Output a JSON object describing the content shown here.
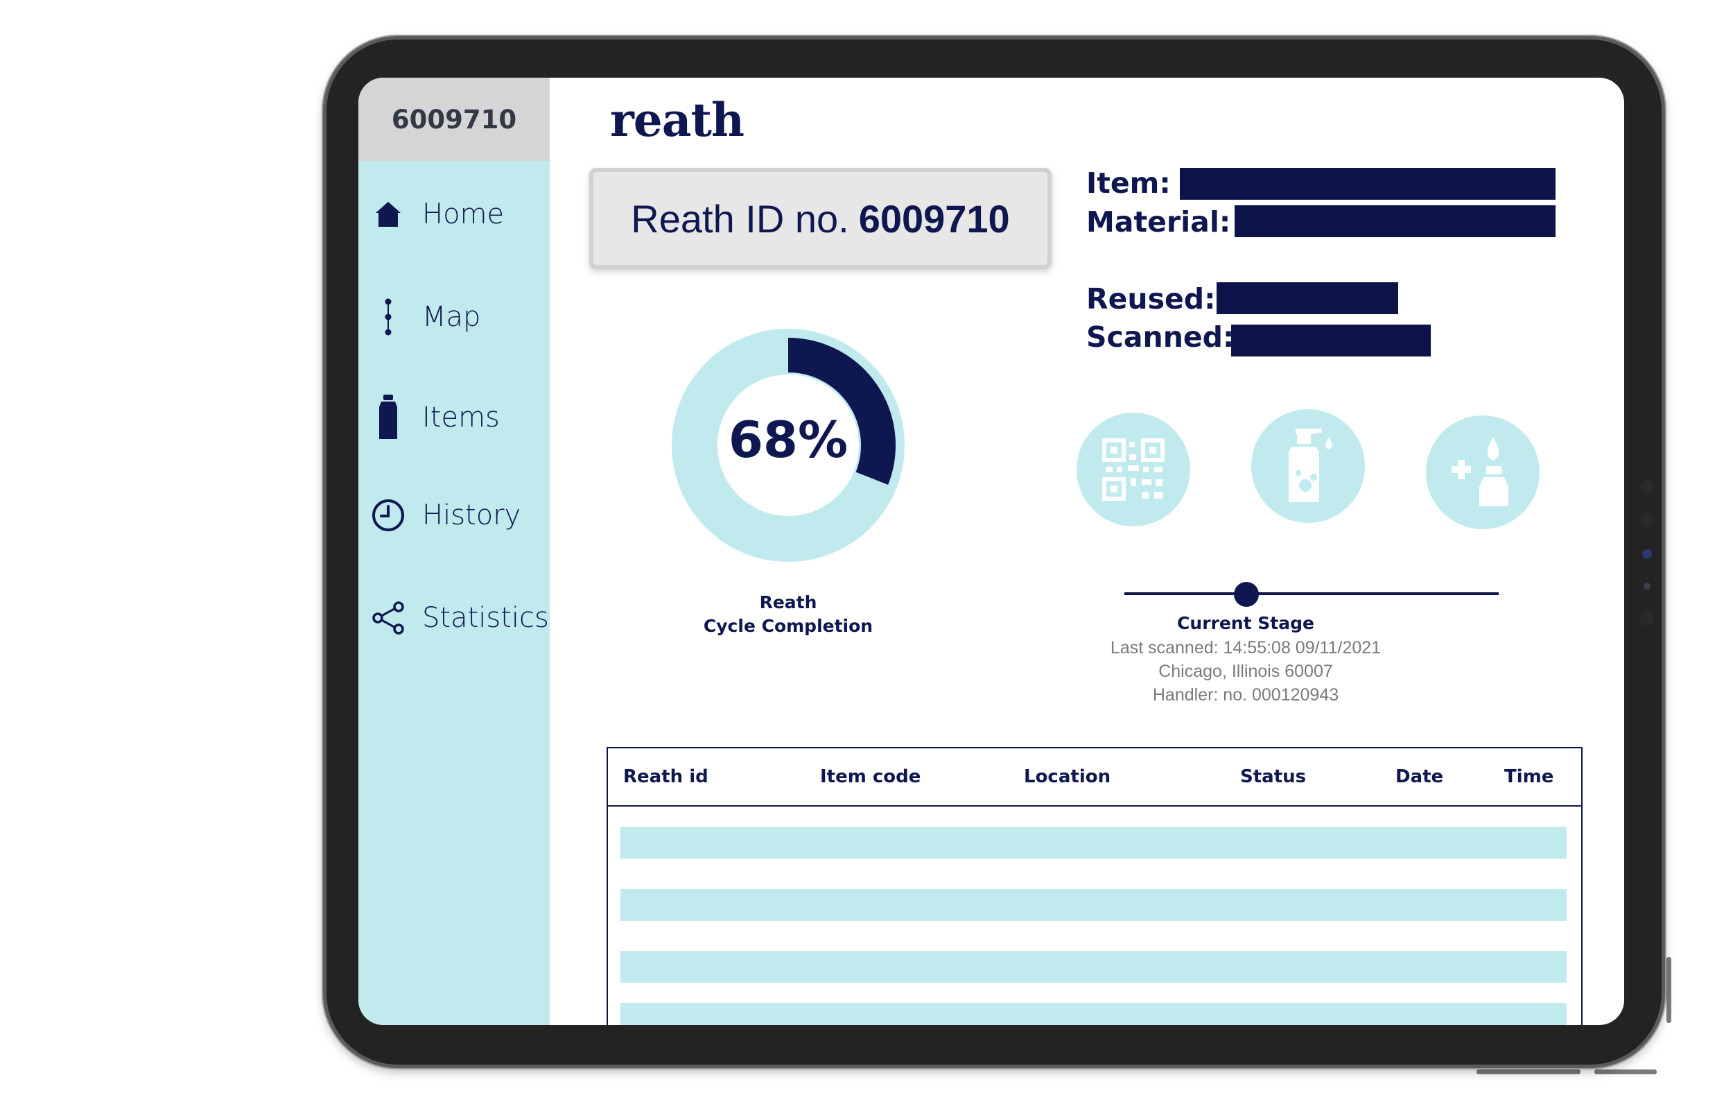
{
  "sidebar": {
    "header_id": "6009710",
    "items": [
      {
        "label": "Home",
        "icon": "home-icon"
      },
      {
        "label": "Map",
        "icon": "map-icon"
      },
      {
        "label": "Items",
        "icon": "bottle-icon"
      },
      {
        "label": "History",
        "icon": "clock-icon"
      },
      {
        "label": "Statistics",
        "icon": "share-icon"
      }
    ]
  },
  "header": {
    "logo": "reath"
  },
  "id_card": {
    "prefix": "Reath ID no.",
    "id": "6009710"
  },
  "completion": {
    "percent_label": "68%",
    "percent_value": 68,
    "caption_line1": "Reath",
    "caption_line2": "Cycle Completion"
  },
  "fields": {
    "item_label": "Item:",
    "material_label": "Material:",
    "reused_label": "Reused:",
    "scanned_label": "Scanned:"
  },
  "stage_icons": [
    "qr-code-icon",
    "soap-bottle-icon",
    "medicine-bottle-icon"
  ],
  "current_stage": {
    "title": "Current Stage",
    "last_scanned": "Last scanned: 14:55:08 09/11/2021",
    "location": "Chicago, Illinois 60007",
    "handler": "Handler: no. 000120943"
  },
  "table": {
    "columns": [
      "Reath id",
      "Item code",
      "Location",
      "Status",
      "Date",
      "Time"
    ]
  },
  "colors": {
    "navy": "#0e1750",
    "light_teal": "#c0eaed",
    "sidebar_header_gray": "#d5d5d5",
    "redaction_bar": "#0c1348"
  }
}
